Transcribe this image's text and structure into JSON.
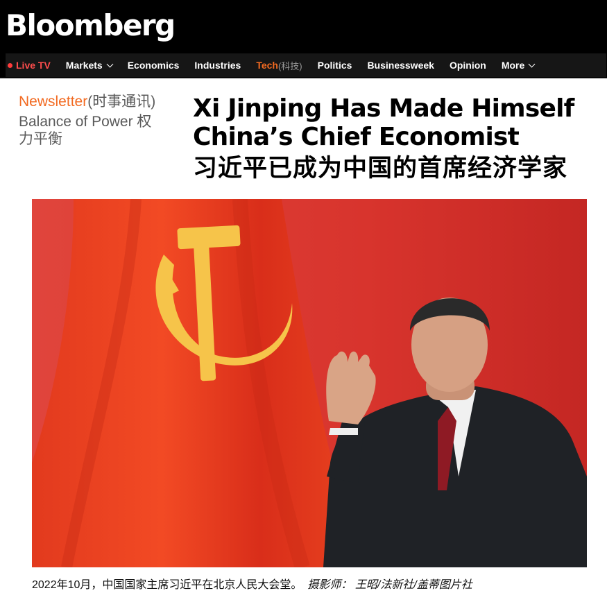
{
  "header": {
    "logo": "Bloomberg"
  },
  "nav": {
    "live_tv": "Live TV",
    "items": [
      {
        "label": "Markets"
      },
      {
        "label": "Economics"
      },
      {
        "label": "Industries"
      },
      {
        "label": "Tech",
        "sub": "(科技)"
      },
      {
        "label": "Politics"
      },
      {
        "label": "Businessweek"
      },
      {
        "label": "Opinion"
      },
      {
        "label": "More"
      }
    ]
  },
  "newsletter": {
    "label": "Newsletter",
    "label_cn": "(时事通讯)",
    "name": "Balance of Power 权力平衡"
  },
  "article": {
    "title_en": "Xi Jinping Has Made Himself China’s Chief Economist",
    "title_cn": "习近平已成为中国的首席经济学家",
    "caption": "2022年10月，中国国家主席习近平在北京人民大会堂。",
    "credit": "摄影师： 王昭/法新社/盖蒂图片社"
  },
  "colors": {
    "accent": "#f26a21",
    "live": "#ff4d4d",
    "background_red": "#d7302b",
    "flag_red": "#ee3a1e",
    "emblem_gold": "#f6c44a"
  },
  "icons": {
    "live_dot": "red-dot",
    "dropdown": "chevron-down-icon",
    "emblem": "hammer-and-sickle-icon"
  }
}
